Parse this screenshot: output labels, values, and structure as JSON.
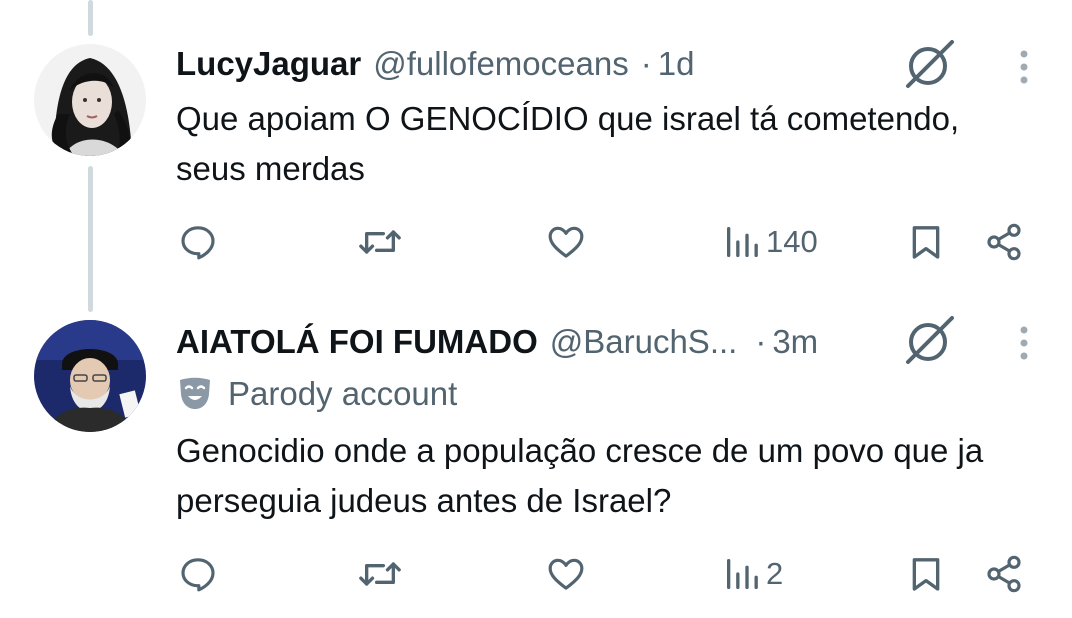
{
  "tweets": [
    {
      "display_name": "LucyJaguar",
      "handle": "@fullofemoceans",
      "separator": "·",
      "time": "1d",
      "text": "Que apoiam O GENOCÍDIO que israel tá cometendo, seus merdas",
      "views": "140",
      "badge": null
    },
    {
      "display_name": "AIATOLÁ FOI FUMADO",
      "handle": "@BaruchS...",
      "separator": "·",
      "time": "3m",
      "badge": "Parody account",
      "text": "Genocidio onde a população cresce de um povo que ja perseguia judeus antes de Israel?",
      "views": "2"
    }
  ],
  "icons": {
    "reply": "speech-bubble-icon",
    "retweet": "retweet-icon",
    "like": "heart-icon",
    "views": "bar-chart-icon",
    "bookmark": "bookmark-icon",
    "share": "share-icon",
    "grok": "grok-icon",
    "more": "more-vertical-icon",
    "parody": "theater-mask-icon"
  },
  "colors": {
    "text_primary": "#0f1419",
    "text_secondary": "#536471",
    "thread_line": "#cfd9de",
    "background": "#ffffff"
  }
}
